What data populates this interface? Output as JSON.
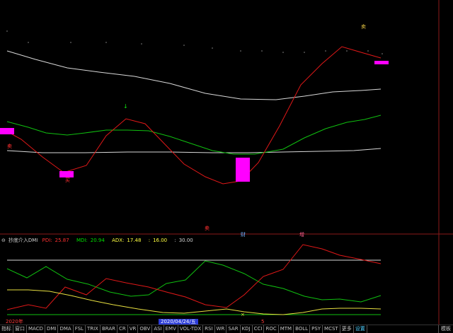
{
  "main_chart": {
    "markers": {
      "sell_top_right": "卖",
      "sell_left": "卖",
      "buy_bottom_left": "买",
      "sell_mid": "卖",
      "cai_label": "财",
      "zeng_label": "增"
    }
  },
  "indicator": {
    "name": "抄底介入DMI",
    "items": [
      {
        "label": "PDI:",
        "value": "25.87",
        "color": "#ff3030"
      },
      {
        "label": "MDI:",
        "value": "20.94",
        "color": "#00e000"
      },
      {
        "label": "ADX:",
        "value": "17.48",
        "color": "#ffff40"
      },
      {
        "label": ":",
        "value": "16.00",
        "color": "#ffff40"
      },
      {
        "label": ":",
        "value": "30.00",
        "color": "#d0d0d0"
      }
    ]
  },
  "date_axis": {
    "left_label": "2020年",
    "cursor_label": "2020/04/24/五",
    "right_label": "5"
  },
  "tabs": [
    "指标",
    "窗口",
    "MACD",
    "DMI",
    "DMA",
    "FSL",
    "TRIX",
    "BRAR",
    "CR",
    "VR",
    "OBV",
    "ASI",
    "EMV",
    "VOL-TDX",
    "RSI",
    "WR",
    "SAR",
    "KDJ",
    "CCI",
    "ROC",
    "MTM",
    "BOLL",
    "PSY",
    "MCST",
    "更多",
    "设置"
  ],
  "right_button": "模板",
  "colors": {
    "red": "#e01818",
    "green": "#10c010",
    "white": "#d8d8d8",
    "yellow": "#e8e040",
    "magenta": "#ff00ff"
  }
}
